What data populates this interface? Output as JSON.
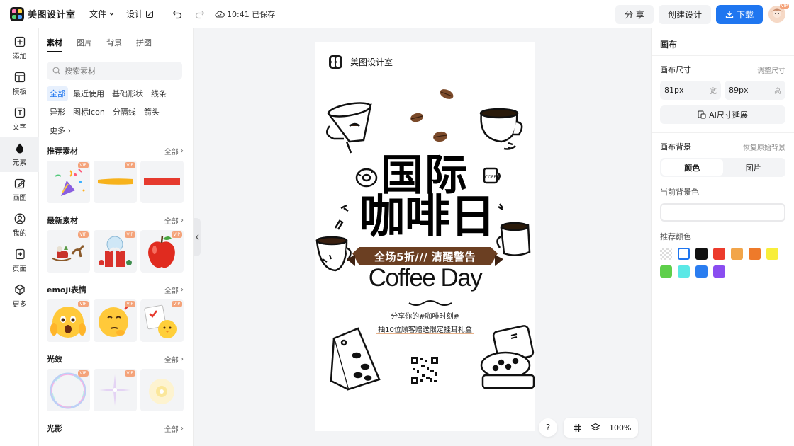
{
  "app": {
    "name": "美图设计室"
  },
  "topbar": {
    "file_menu": "文件",
    "design_menu": "设计",
    "save_status": "10:41 已保存",
    "share_label": "分 享",
    "create_label": "创建设计",
    "download_label": "下载",
    "avatar_badge": "VIP",
    "accent": "#1f76f0"
  },
  "leftnav": [
    {
      "label": "添加",
      "icon": "plus-square-icon"
    },
    {
      "label": "模板",
      "icon": "template-icon"
    },
    {
      "label": "文字",
      "icon": "text-icon"
    },
    {
      "label": "元素",
      "icon": "shapes-icon"
    },
    {
      "label": "画图",
      "icon": "pencil-icon"
    },
    {
      "label": "我的",
      "icon": "user-icon"
    },
    {
      "label": "页面",
      "icon": "page-add-icon"
    },
    {
      "label": "更多",
      "icon": "cube-icon"
    }
  ],
  "panel": {
    "tabs": [
      "素材",
      "图片",
      "背景",
      "拼图"
    ],
    "search_placeholder": "搜索素材",
    "chips": [
      "全部",
      "最近使用",
      "基础形状",
      "线条",
      "异形",
      "图标icon",
      "分隔线",
      "箭头",
      "更多"
    ],
    "vip": "VIP",
    "all_label": "全部",
    "sections": [
      {
        "title": "推荐素材",
        "items": [
          "party-popper",
          "yellow-brush-stroke",
          "red-bar"
        ]
      },
      {
        "title": "最新素材",
        "items": [
          "christmas-sleigh",
          "christmas-gift",
          "red-apple"
        ]
      },
      {
        "title": "emoji表情",
        "items": [
          "fearful-emoji",
          "thinking-emoji",
          "checklist-chick-emoji"
        ]
      },
      {
        "title": "光效",
        "items": [
          "bubble-ring-light",
          "sparkle-light",
          "soft-glow-light"
        ]
      },
      {
        "title": "光影",
        "items": []
      }
    ]
  },
  "poster": {
    "brand": "美图设计室",
    "title_line1": "国际",
    "title_line2": "咖啡日",
    "ribbon_text": "全场5折/// 清醒警告",
    "english_title": "Coffee Day",
    "share_text": "分享你的#咖啡时刻#",
    "lottery_text": "抽10位顾客赠送限定挂耳礼盒",
    "cup_label": "COFFEE",
    "ribbon_color": "#6b3f22"
  },
  "bottom_tools": {
    "help": "?",
    "zoom": "100%"
  },
  "right": {
    "title": "画布",
    "size_label": "画布尺寸",
    "adjust_link": "调整尺寸",
    "width_value": "81px",
    "width_unit": "宽",
    "height_value": "89px",
    "height_unit": "高",
    "ai_button": "AI尺寸延展",
    "bg_label": "画布背景",
    "restore_link": "恢复原始背景",
    "seg_color": "颜色",
    "seg_image": "图片",
    "current_bg_label": "当前背景色",
    "recommend_label": "推荐颜色",
    "swatches": [
      "transparent",
      "#ffffff",
      "#111111",
      "#ec3b2c",
      "#f2a54a",
      "#ee7a2a",
      "#f8ee3a",
      "#5fcf4b",
      "#5be8e6",
      "#2a7df0",
      "#8a4df0"
    ]
  }
}
